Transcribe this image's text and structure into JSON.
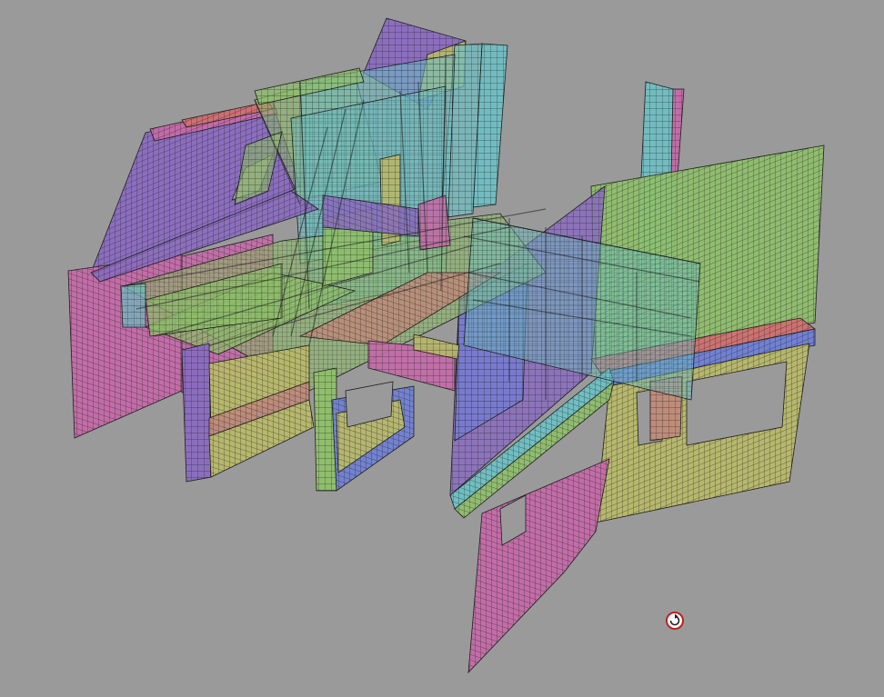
{
  "viewport": {
    "background_color": "#9a9a9a",
    "panel_colors": {
      "magenta": "#c46aa8",
      "purple": "#8a6cc0",
      "green": "#8fc06a",
      "olive": "#b8b86a",
      "blue": "#6f7fd6",
      "cyan": "#6ec0c4",
      "red": "#d07070",
      "salmon": "#c08a7a"
    },
    "mesh_line_color": "#1e1e1e",
    "rotate_cursor_icon": "rotate-cursor-icon"
  }
}
